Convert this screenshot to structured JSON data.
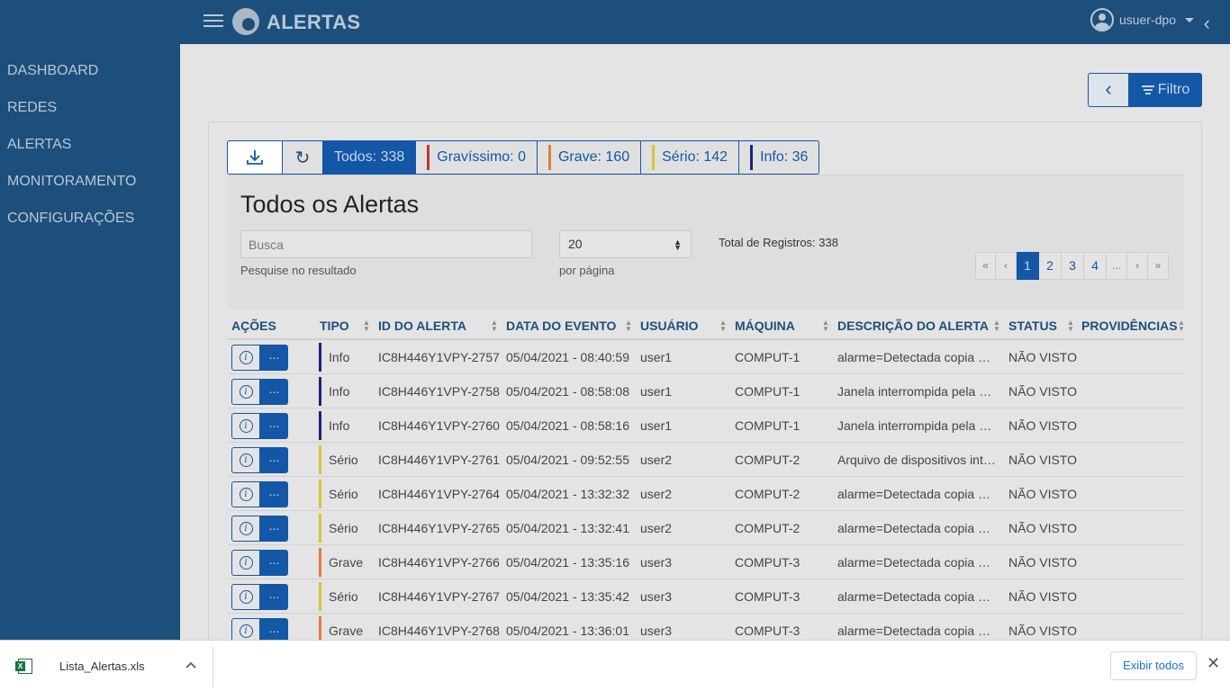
{
  "header": {
    "app_title": "ALERTAS",
    "username": "usuer-dpo",
    "collapse_glyph": "‹"
  },
  "sidebar": {
    "items": [
      {
        "label": "DASHBOARD"
      },
      {
        "label": "REDES"
      },
      {
        "label": "ALERTAS"
      },
      {
        "label": "MONITORAMENTO"
      },
      {
        "label": "CONFIGURAÇÕES"
      }
    ]
  },
  "filter": {
    "back_glyph": "‹",
    "label": "Filtro"
  },
  "tabs": {
    "download_glyph": "⤓",
    "refresh_glyph": "↻",
    "items": [
      {
        "label": "Todos: 338",
        "color": ""
      },
      {
        "label": "Gravíssimo: 0",
        "color": "#c0392b"
      },
      {
        "label": "Grave: 160",
        "color": "#e07b39"
      },
      {
        "label": "Sério: 142",
        "color": "#d4c43a"
      },
      {
        "label": "Info: 36",
        "color": "#1a237e"
      }
    ]
  },
  "list": {
    "title": "Todos os Alertas",
    "search_placeholder": "Busca",
    "search_help": "Pesquise no resultado",
    "per_page_value": "20",
    "per_page_label": "por página",
    "total": "Total de Registros: 338"
  },
  "pagination": {
    "first": "«",
    "prev": "‹",
    "pages": [
      "1",
      "2",
      "3",
      "4"
    ],
    "ellipsis": "...",
    "next": "›",
    "last": "»",
    "current": "1"
  },
  "table": {
    "columns": [
      "AÇÕES",
      "TIPO",
      "ID DO ALERTA",
      "DATA DO EVENTO",
      "USUÁRIO",
      "MÁQUINA",
      "DESCRIÇÃO DO ALERTA",
      "STATUS",
      "PROVIDÊNCIAS"
    ],
    "rows": [
      {
        "tipo": "Info",
        "color": "#1a237e",
        "id": "IC8H446Y1VPY-2757",
        "data": "05/04/2021 - 08:40:59",
        "usuario": "user1",
        "maquina": "COMPUT-1",
        "descricao": "alarme=Detectada copia de arquivo",
        "status": "NÃO VISTO"
      },
      {
        "tipo": "Info",
        "color": "#1a237e",
        "id": "IC8H446Y1VPY-2758",
        "data": "05/04/2021 - 08:58:08",
        "usuario": "user1",
        "maquina": "COMPUT-1",
        "descricao": "Janela interrompida pela captura",
        "status": "NÃO VISTO"
      },
      {
        "tipo": "Info",
        "color": "#1a237e",
        "id": "IC8H446Y1VPY-2760",
        "data": "05/04/2021 - 08:58:16",
        "usuario": "user1",
        "maquina": "COMPUT-1",
        "descricao": "Janela interrompida pela captura",
        "status": "NÃO VISTO"
      },
      {
        "tipo": "Sério",
        "color": "#d4c43a",
        "id": "IC8H446Y1VPY-2761",
        "data": "05/04/2021 - 09:52:55",
        "usuario": "user2",
        "maquina": "COMPUT-2",
        "descricao": "Arquivo de dispositivos interno",
        "status": "NÃO VISTO"
      },
      {
        "tipo": "Sério",
        "color": "#d4c43a",
        "id": "IC8H446Y1VPY-2764",
        "data": "05/04/2021 - 13:32:32",
        "usuario": "user2",
        "maquina": "COMPUT-2",
        "descricao": "alarme=Detectada copia de arquivo",
        "status": "NÃO VISTO"
      },
      {
        "tipo": "Sério",
        "color": "#d4c43a",
        "id": "IC8H446Y1VPY-2765",
        "data": "05/04/2021 - 13:32:41",
        "usuario": "user2",
        "maquina": "COMPUT-2",
        "descricao": "alarme=Detectada copia de arquivo",
        "status": "NÃO VISTO"
      },
      {
        "tipo": "Grave",
        "color": "#e07b39",
        "id": "IC8H446Y1VPY-2766",
        "data": "05/04/2021 - 13:35:16",
        "usuario": "user3",
        "maquina": "COMPUT-3",
        "descricao": "alarme=Detectada copia de arquivo",
        "status": "NÃO VISTO"
      },
      {
        "tipo": "Sério",
        "color": "#d4c43a",
        "id": "IC8H446Y1VPY-2767",
        "data": "05/04/2021 - 13:35:42",
        "usuario": "user3",
        "maquina": "COMPUT-3",
        "descricao": "alarme=Detectada copia de arquivo",
        "status": "NÃO VISTO"
      },
      {
        "tipo": "Grave",
        "color": "#e07b39",
        "id": "IC8H446Y1VPY-2768",
        "data": "05/04/2021 - 13:36:01",
        "usuario": "user3",
        "maquina": "COMPUT-3",
        "descricao": "alarme=Detectada copia de arquivo",
        "status": "NÃO VISTO"
      }
    ],
    "info_glyph": "i",
    "more_glyph": "..."
  },
  "downloads": {
    "file_name": "Lista_Alertas.xls",
    "caret_glyph": "^",
    "show_all_label": "Exibir todos",
    "close_glyph": "✕"
  }
}
